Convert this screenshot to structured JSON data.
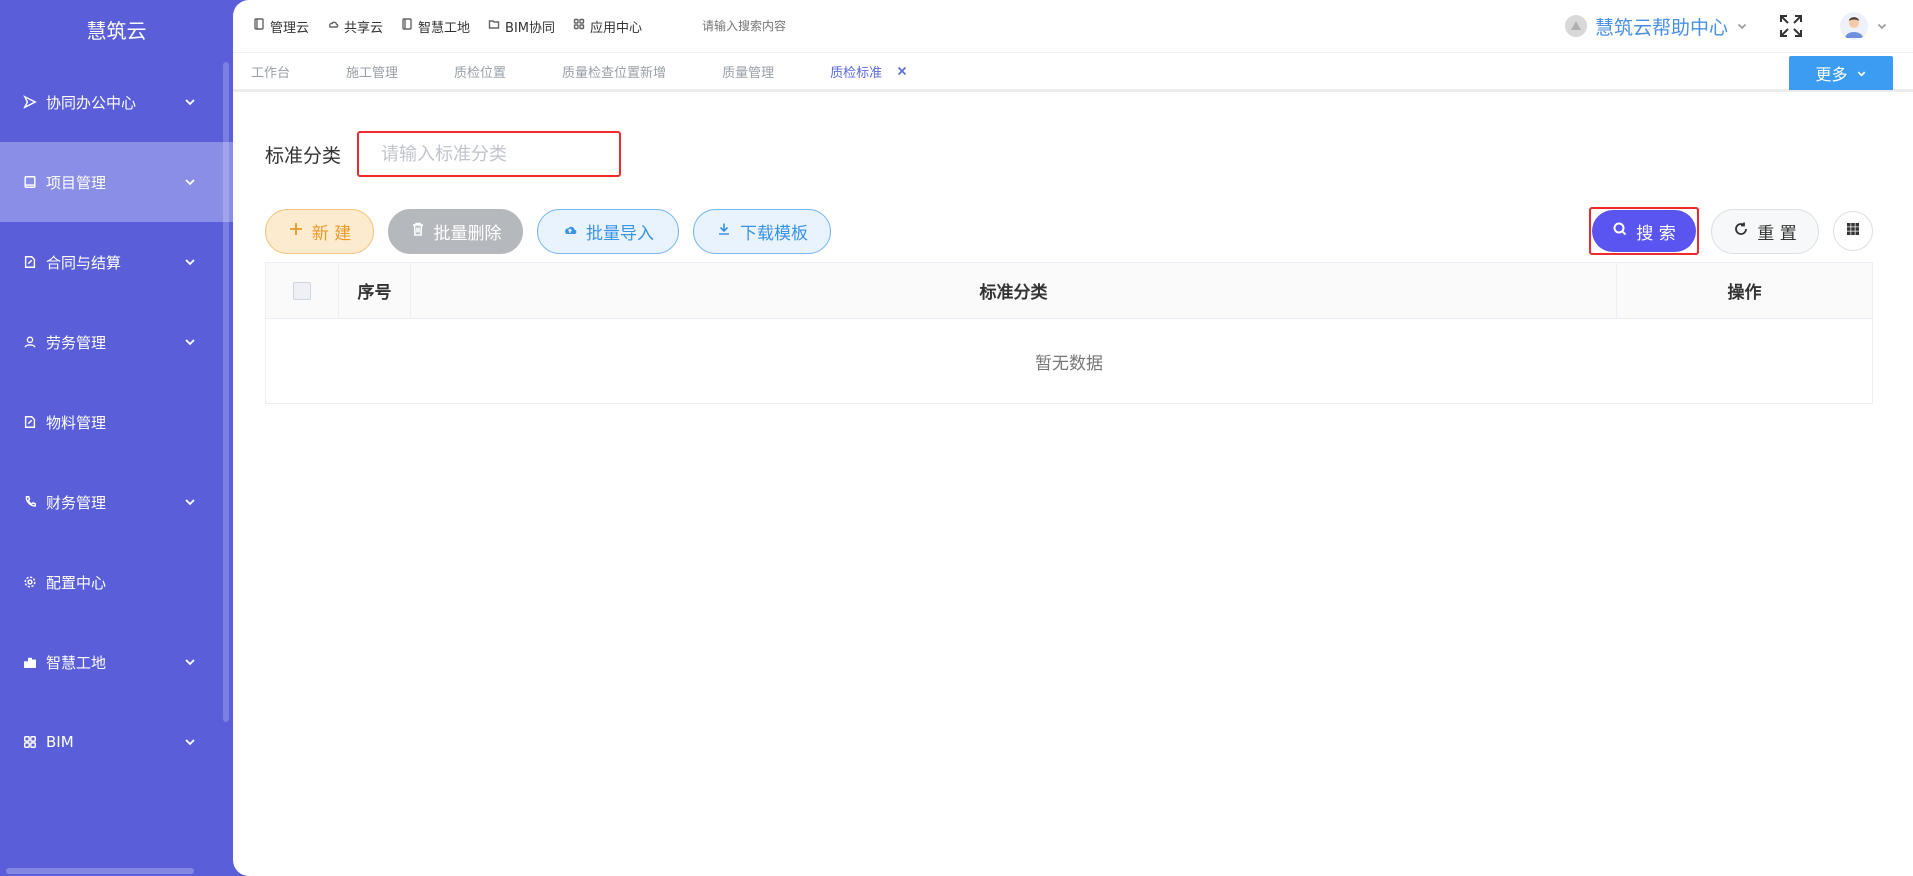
{
  "brand": "慧筑云",
  "sidebar": {
    "items": [
      {
        "label": "协同办公中心",
        "icon": "send-icon",
        "has_children": true
      },
      {
        "label": "项目管理",
        "icon": "book-icon",
        "has_children": true
      },
      {
        "label": "合同与结算",
        "icon": "edit-doc-icon",
        "has_children": true
      },
      {
        "label": "劳务管理",
        "icon": "user-icon",
        "has_children": true
      },
      {
        "label": "物料管理",
        "icon": "edit-doc-icon",
        "has_children": false
      },
      {
        "label": "财务管理",
        "icon": "phone-icon",
        "has_children": true
      },
      {
        "label": "配置中心",
        "icon": "gear-icon",
        "has_children": false
      },
      {
        "label": "智慧工地",
        "icon": "bar-chart-icon",
        "has_children": true
      },
      {
        "label": "BIM",
        "icon": "grid-icon",
        "has_children": true
      }
    ]
  },
  "topnav": {
    "items": [
      {
        "label": "管理云",
        "icon": "book-icon"
      },
      {
        "label": "共享云",
        "icon": "cloud-icon"
      },
      {
        "label": "智慧工地",
        "icon": "book-icon"
      },
      {
        "label": "BIM协同",
        "icon": "folder-icon"
      },
      {
        "label": "应用中心",
        "icon": "grid-icon"
      }
    ],
    "search_placeholder": "请输入搜索内容",
    "help_label": "慧筑云帮助中心"
  },
  "tabs": [
    {
      "label": "工作台"
    },
    {
      "label": "施工管理"
    },
    {
      "label": "质检位置"
    },
    {
      "label": "质量检查位置新增"
    },
    {
      "label": "质量管理"
    },
    {
      "label": "质检标准"
    }
  ],
  "more_label": "更多",
  "filter": {
    "label": "标准分类",
    "placeholder": "请输入标准分类"
  },
  "toolbar": {
    "new_label": "新 建",
    "batch_delete_label": "批量删除",
    "batch_import_label": "批量导入",
    "download_template_label": "下载模板",
    "search_label": "搜 索",
    "reset_label": "重 置"
  },
  "table": {
    "columns": [
      "序号",
      "标准分类",
      "操作"
    ],
    "empty_text": "暂无数据"
  },
  "colors": {
    "sidebar_bg": "#5a5fd9",
    "accent": "#5a55f0",
    "highlight": "#ee2b2b"
  }
}
